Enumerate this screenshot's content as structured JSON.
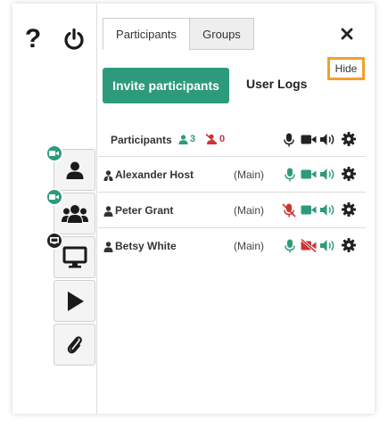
{
  "rail": {
    "help_label": "?",
    "buttons": [
      {
        "name": "user-button",
        "icon": "user-icon",
        "badge": "video-icon"
      },
      {
        "name": "group-button",
        "icon": "group-icon",
        "badge": "video-icon"
      },
      {
        "name": "screenshare-button",
        "icon": "monitor-icon",
        "badge": "screen-icon"
      },
      {
        "name": "play-button",
        "icon": "play-icon"
      },
      {
        "name": "attachment-button",
        "icon": "paperclip-icon"
      }
    ]
  },
  "tabs": [
    {
      "label": "Participants",
      "active": true
    },
    {
      "label": "Groups",
      "active": false
    }
  ],
  "hide_label": "Hide",
  "invite_label": "Invite participants",
  "user_logs_label": "User Logs",
  "participants_header": {
    "label": "Participants",
    "online_count": "3",
    "offline_count": "0"
  },
  "participants": [
    {
      "name": "Alexander Host",
      "room": "(Main)",
      "role": "host",
      "mic": "on",
      "camera": "on",
      "audio": "on"
    },
    {
      "name": "Peter Grant",
      "room": "(Main)",
      "role": "participant",
      "mic": "muted",
      "camera": "on",
      "audio": "on"
    },
    {
      "name": "Betsy White",
      "room": "(Main)",
      "role": "participant",
      "mic": "on",
      "camera": "off",
      "audio": "on"
    }
  ],
  "colors": {
    "accent_green": "#2d9b7b",
    "muted_red": "#cc3333",
    "highlight_orange": "#f0a030",
    "icon_dark": "#222222"
  }
}
